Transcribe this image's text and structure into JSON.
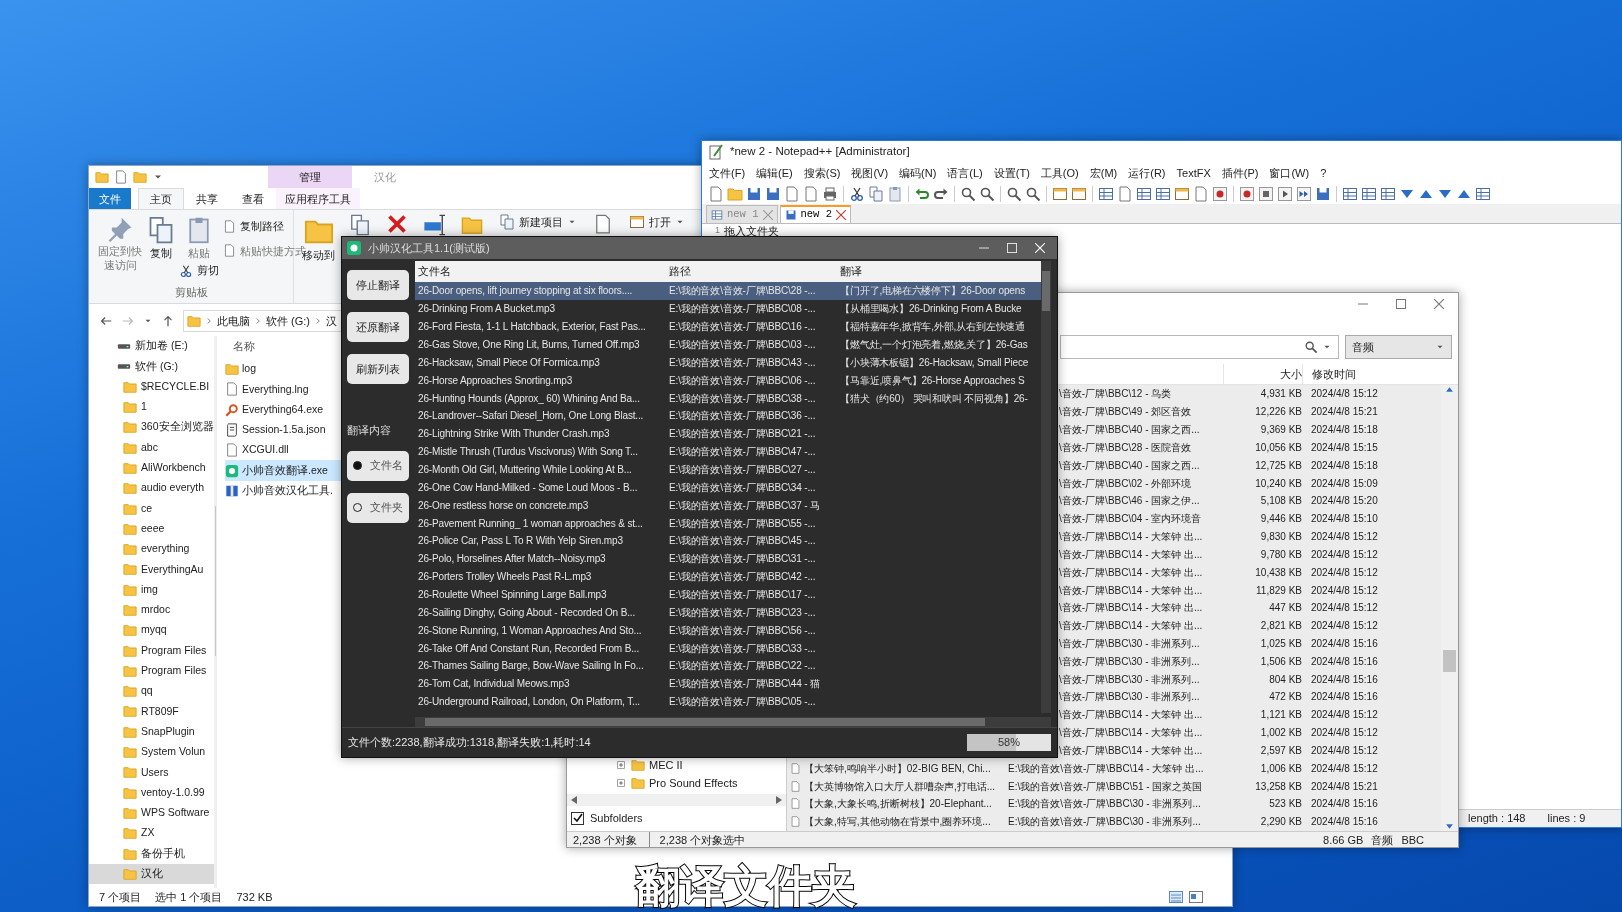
{
  "explorer": {
    "title": "汉化",
    "context_tab": "管理",
    "ribbon_tabs": [
      {
        "label": "文件",
        "kind": "file",
        "selected": false
      },
      {
        "label": "主页",
        "kind": "tab",
        "selected": true
      },
      {
        "label": "共享",
        "kind": "tab",
        "selected": false
      },
      {
        "label": "查看",
        "kind": "tab",
        "selected": false
      },
      {
        "label": "应用程序工具",
        "kind": "context",
        "selected": false
      }
    ],
    "ribbon": {
      "pin": "固定到快速访问",
      "copy": "复制",
      "paste": "粘贴",
      "cut": "剪切",
      "copy_path": "复制路径",
      "paste_shortcut": "粘贴快捷方式",
      "group": "剪贴板",
      "move_to": "移动到",
      "new_item": "新建项目",
      "open": "打开"
    },
    "address": [
      "此电脑",
      "软件 (G:)",
      "汉"
    ],
    "tree": [
      {
        "label": "新加卷 (E:)",
        "kind": "drive",
        "selected": false
      },
      {
        "label": "软件 (G:)",
        "kind": "drive",
        "selected": false
      },
      {
        "label": "$RECYCLE.BI",
        "kind": "folder",
        "selected": false
      },
      {
        "label": "1",
        "kind": "folder",
        "selected": false
      },
      {
        "label": "360安全浏览器",
        "kind": "folder",
        "selected": false
      },
      {
        "label": "abc",
        "kind": "folder",
        "selected": false
      },
      {
        "label": "AliWorkbench",
        "kind": "folder",
        "selected": false
      },
      {
        "label": "audio everyth",
        "kind": "folder",
        "selected": false
      },
      {
        "label": "ce",
        "kind": "folder",
        "selected": false
      },
      {
        "label": "eeee",
        "kind": "folder",
        "selected": false
      },
      {
        "label": "everything",
        "kind": "folder",
        "selected": false
      },
      {
        "label": "EverythingAu",
        "kind": "folder",
        "selected": false
      },
      {
        "label": "img",
        "kind": "folder",
        "selected": false
      },
      {
        "label": "mrdoc",
        "kind": "folder",
        "selected": false
      },
      {
        "label": "myqq",
        "kind": "folder",
        "selected": false
      },
      {
        "label": "Program Files",
        "kind": "folder",
        "selected": false
      },
      {
        "label": "Program Files",
        "kind": "folder",
        "selected": false
      },
      {
        "label": "qq",
        "kind": "folder",
        "selected": false
      },
      {
        "label": "RT809F",
        "kind": "folder",
        "selected": false
      },
      {
        "label": "SnapPlugin",
        "kind": "folder",
        "selected": false
      },
      {
        "label": "System Volun",
        "kind": "folder",
        "selected": false
      },
      {
        "label": "Users",
        "kind": "folder",
        "selected": false
      },
      {
        "label": "ventoy-1.0.99",
        "kind": "folder",
        "selected": false
      },
      {
        "label": "WPS Software",
        "kind": "folder",
        "selected": false
      },
      {
        "label": "ZX",
        "kind": "folder",
        "selected": false
      },
      {
        "label": "备份手机",
        "kind": "folder",
        "selected": false
      },
      {
        "label": "汉化",
        "kind": "folder",
        "selected": true
      }
    ],
    "list_header": "名称",
    "files": [
      {
        "name": "log",
        "kind": "folder",
        "selected": false
      },
      {
        "name": "Everything.lng",
        "kind": "text",
        "selected": false
      },
      {
        "name": "Everything64.exe",
        "kind": "search",
        "selected": false
      },
      {
        "name": "Session-1.5a.json",
        "kind": "script",
        "selected": false
      },
      {
        "name": "XCGUI.dll",
        "kind": "text",
        "selected": false
      },
      {
        "name": "小帅音效翻译.exe",
        "kind": "app",
        "selected": true
      },
      {
        "name": "小帅音效汉化工具.",
        "kind": "archive",
        "selected": false
      }
    ],
    "status": [
      "7 个项目",
      "选中 1 个项目",
      "732 KB"
    ]
  },
  "notepad": {
    "title": "*new 2 - Notepad++ [Administrator]",
    "menus": [
      "文件(F)",
      "编辑(E)",
      "搜索(S)",
      "视图(V)",
      "编码(N)",
      "语言(L)",
      "设置(T)",
      "工具(O)",
      "宏(M)",
      "运行(R)",
      "TextFX",
      "插件(P)",
      "窗口(W)",
      "?"
    ],
    "tabs": [
      {
        "label": "new 1",
        "selected": false
      },
      {
        "label": "new 2",
        "selected": true
      }
    ],
    "lines": [
      {
        "number": "1",
        "text": "拖入文件夹"
      }
    ],
    "status": [
      "length : 148",
      "lines : 9"
    ]
  },
  "everything": {
    "filter": "音频",
    "columns": [
      "大小",
      "修改时间"
    ],
    "tree": [
      "MEC II",
      "Pro Sound Effects"
    ],
    "subfolders": {
      "label": "Subfolders",
      "checked": true
    },
    "rows": [
      {
        "path": "\\音效-厂牌\\BBC\\12 - 鸟类",
        "size": "4,931 KB",
        "date": "2024/4/8 15:12"
      },
      {
        "path": "\\音效-厂牌\\BBC\\49 - 郊区音效",
        "size": "12,226 KB",
        "date": "2024/4/8 15:21"
      },
      {
        "path": "\\音效-厂牌\\BBC\\40 - 国家之西...",
        "size": "9,369 KB",
        "date": "2024/4/8 15:18"
      },
      {
        "path": "\\音效-厂牌\\BBC\\28 - 医院音效",
        "size": "10,056 KB",
        "date": "2024/4/8 15:15"
      },
      {
        "path": "\\音效-厂牌\\BBC\\40 - 国家之西...",
        "size": "12,725 KB",
        "date": "2024/4/8 15:18"
      },
      {
        "path": "\\音效-厂牌\\BBC\\02 - 外部环境",
        "size": "10,240 KB",
        "date": "2024/4/8 15:09"
      },
      {
        "path": "\\音效-厂牌\\BBC\\46 - 国家之伊...",
        "size": "5,108 KB",
        "date": "2024/4/8 15:20"
      },
      {
        "path": "\\音效-厂牌\\BBC\\04 - 室内环境音",
        "size": "9,446 KB",
        "date": "2024/4/8 15:10"
      },
      {
        "path": "\\音效-厂牌\\BBC\\14 - 大笨钟 出...",
        "size": "9,830 KB",
        "date": "2024/4/8 15:12"
      },
      {
        "path": "\\音效-厂牌\\BBC\\14 - 大笨钟 出...",
        "size": "9,780 KB",
        "date": "2024/4/8 15:12"
      },
      {
        "path": "\\音效-厂牌\\BBC\\14 - 大笨钟 出...",
        "size": "10,438 KB",
        "date": "2024/4/8 15:12"
      },
      {
        "path": "\\音效-厂牌\\BBC\\14 - 大笨钟 出...",
        "size": "11,829 KB",
        "date": "2024/4/8 15:12"
      },
      {
        "path": "\\音效-厂牌\\BBC\\14 - 大笨钟 出...",
        "size": "447 KB",
        "date": "2024/4/8 15:12"
      },
      {
        "path": "\\音效-厂牌\\BBC\\14 - 大笨钟 出...",
        "size": "2,821 KB",
        "date": "2024/4/8 15:12"
      },
      {
        "path": "\\音效-厂牌\\BBC\\30 - 非洲系列...",
        "size": "1,025 KB",
        "date": "2024/4/8 15:16"
      },
      {
        "path": "\\音效-厂牌\\BBC\\30 - 非洲系列...",
        "size": "1,506 KB",
        "date": "2024/4/8 15:16"
      },
      {
        "path": "\\音效-厂牌\\BBC\\30 - 非洲系列...",
        "size": "804 KB",
        "date": "2024/4/8 15:16"
      },
      {
        "path": "\\音效-厂牌\\BBC\\30 - 非洲系列...",
        "size": "472 KB",
        "date": "2024/4/8 15:16"
      },
      {
        "path": "\\音效-厂牌\\BBC\\14 - 大笨钟 出...",
        "size": "1,121 KB",
        "date": "2024/4/8 15:12"
      },
      {
        "path": "\\音效-厂牌\\BBC\\14 - 大笨钟 出...",
        "size": "1,002 KB",
        "date": "2024/4/8 15:12"
      },
      {
        "path": "\\音效-厂牌\\BBC\\14 - 大笨钟 出...",
        "size": "2,597 KB",
        "date": "2024/4/8 15:12"
      },
      {
        "name": "【大笨钟,鸣响半小时】02-BIG BEN, Chi...",
        "path": "E:\\我的音效\\音效-厂牌\\BBC\\14 - 大笨钟 出...",
        "size": "1,006 KB",
        "date": "2024/4/8 15:12"
      },
      {
        "name": "【大英博物馆入口大厅人群嘈杂声,打电话...",
        "path": "E:\\我的音效\\音效-厂牌\\BBC\\51 - 国家之英国",
        "size": "13,258 KB",
        "date": "2024/4/8 15:21"
      },
      {
        "name": "【大象,大象长鸣,折断树枝】20-Elephant...",
        "path": "E:\\我的音效\\音效-厂牌\\BBC\\30 - 非洲系列...",
        "size": "523 KB",
        "date": "2024/4/8 15:16"
      },
      {
        "name": "【大象,特写,其他动物在背景中,圈养环境...",
        "path": "E:\\我的音效\\音效-厂牌\\BBC\\30 - 非洲系列...",
        "size": "2,290 KB",
        "date": "2024/4/8 15:16"
      }
    ],
    "status": [
      "2,238 个对象",
      "2,238 个对象选中"
    ],
    "status_right": [
      "8.66 GB",
      "音频",
      "BBC"
    ]
  },
  "tool": {
    "title": "小帅汉化工具1.1(测试版)",
    "buttons": [
      "停止翻译",
      "还原翻译",
      "刷新列表"
    ],
    "mode_label": "翻译内容",
    "modes": [
      {
        "label": "文件名",
        "selected": true
      },
      {
        "label": "文件夹",
        "selected": false
      }
    ],
    "columns": [
      "文件名",
      "路径",
      "翻译"
    ],
    "rows": [
      {
        "name": "26-Door opens, lift journey stopping at six floors....",
        "path": "E:\\我的音效\\音效-厂牌\\BBC\\28 -...",
        "translation": "【门开了,电梯在六楼停下】26-Door opens",
        "selected": true
      },
      {
        "name": "26-Drinking From A Bucket.mp3",
        "path": "E:\\我的音效\\音效-厂牌\\BBC\\08 -...",
        "translation": "【从桶里喝水】26-Drinking From A Bucke",
        "selected": false
      },
      {
        "name": "26-Ford Fiesta, 1-1 L Hatchback, Exterior, Fast Pas...",
        "path": "E:\\我的音效\\音效-厂牌\\BBC\\16 -...",
        "translation": "【福特嘉年华,掀背车,外部,从右到左快速通",
        "selected": false
      },
      {
        "name": "26-Gas Stove, One Ring Lit, Burns, Turned Off.mp3",
        "path": "E:\\我的音效\\音效-厂牌\\BBC\\03 -...",
        "translation": "【燃气灶,一个灯泡亮着,燃烧,关了】26-Gas",
        "selected": false
      },
      {
        "name": "26-Hacksaw, Small Piece Of Formica.mp3",
        "path": "E:\\我的音效\\音效-厂牌\\BBC\\43 -...",
        "translation": "【小块薄木板锯】26-Hacksaw, Small Piece",
        "selected": false
      },
      {
        "name": "26-Horse Approaches Snorting.mp3",
        "path": "E:\\我的音效\\音效-厂牌\\BBC\\06 -...",
        "translation": "【马靠近,喷鼻气】26-Horse Approaches S",
        "selected": false
      },
      {
        "name": "26-Hunting Hounds (Approx_ 60) Whining And Ba...",
        "path": "E:\\我的音效\\音效-厂牌\\BBC\\38 -...",
        "translation": "【猎犬（约60） 哭叫和吠叫 不同视角】26-",
        "selected": false
      },
      {
        "name": "26-Landrover--Safari Diesel_Horn, One Long Blast...",
        "path": "E:\\我的音效\\音效-厂牌\\BBC\\36 -...",
        "selected": false
      },
      {
        "name": "26-Lightning Strike With Thunder Crash.mp3",
        "path": "E:\\我的音效\\音效-厂牌\\BBC\\21 -...",
        "selected": false
      },
      {
        "name": "26-Mistle Thrush (Turdus Viscivorus) With Song T...",
        "path": "E:\\我的音效\\音效-厂牌\\BBC\\47 -...",
        "selected": false
      },
      {
        "name": "26-Month Old Girl, Muttering While Looking At B...",
        "path": "E:\\我的音效\\音效-厂牌\\BBC\\27 -...",
        "selected": false
      },
      {
        "name": "26-One Cow Hand-Milked - Some Loud Moos - B...",
        "path": "E:\\我的音效\\音效-厂牌\\BBC\\34 -...",
        "selected": false
      },
      {
        "name": "26-One restless horse on concrete.mp3",
        "path": "E:\\我的音效\\音效-厂牌\\BBC\\37 - 马",
        "selected": false
      },
      {
        "name": "26-Pavement Running_ 1 woman approaches & st...",
        "path": "E:\\我的音效\\音效-厂牌\\BBC\\55 -...",
        "selected": false
      },
      {
        "name": "26-Police Car, Pass L To R With Yelp Siren.mp3",
        "path": "E:\\我的音效\\音效-厂牌\\BBC\\45 -...",
        "selected": false
      },
      {
        "name": "26-Polo, Horselines After Match--Noisy.mp3",
        "path": "E:\\我的音效\\音效-厂牌\\BBC\\31 -...",
        "selected": false
      },
      {
        "name": "26-Porters Trolley Wheels Past R-L.mp3",
        "path": "E:\\我的音效\\音效-厂牌\\BBC\\42 -...",
        "selected": false
      },
      {
        "name": "26-Roulette Wheel Spinning Large Ball.mp3",
        "path": "E:\\我的音效\\音效-厂牌\\BBC\\17 -...",
        "selected": false
      },
      {
        "name": "26-Sailing Dinghy, Going About - Recorded On B...",
        "path": "E:\\我的音效\\音效-厂牌\\BBC\\23 -...",
        "selected": false
      },
      {
        "name": "26-Stone Running, 1 Woman Approaches And Sto...",
        "path": "E:\\我的音效\\音效-厂牌\\BBC\\56 -...",
        "selected": false
      },
      {
        "name": "26-Take Off And Constant Run, Recorded From B...",
        "path": "E:\\我的音效\\音效-厂牌\\BBC\\33 -...",
        "selected": false
      },
      {
        "name": "26-Thames Sailing Barge, Bow-Wave Sailing In Fo...",
        "path": "E:\\我的音效\\音效-厂牌\\BBC\\22 -...",
        "selected": false
      },
      {
        "name": "26-Tom Cat, Individual Meows.mp3",
        "path": "E:\\我的音效\\音效-厂牌\\BBC\\44 - 猫",
        "selected": false
      },
      {
        "name": "26-Underground Railroad, London, On Platform, T...",
        "path": "E:\\我的音效\\音效-厂牌\\BBC\\05 -...",
        "selected": false
      }
    ],
    "status": "文件个数:2238,翻译成功:1318,翻译失败:1,耗时:14",
    "progress": {
      "level": 0.58,
      "reading": "58%"
    }
  },
  "caption": "翻译文件夹"
}
